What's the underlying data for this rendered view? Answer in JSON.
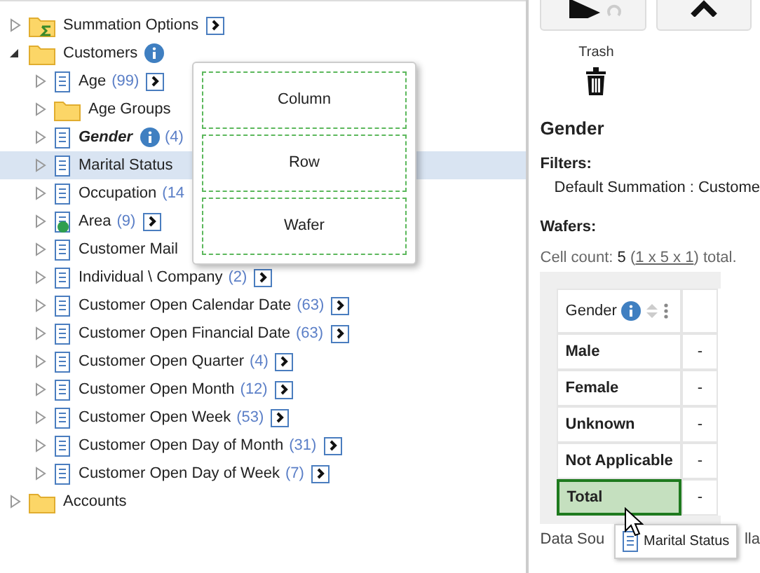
{
  "tree": [
    {
      "label": "Summation Options",
      "kind": "sum-folder",
      "expanded": false,
      "has_menu": true
    },
    {
      "label": "Customers",
      "kind": "folder",
      "expanded": true,
      "has_info": true,
      "children": [
        {
          "label": "Age",
          "count": "(99)",
          "kind": "doc",
          "expanded": false,
          "has_menu": true,
          "selected": false
        },
        {
          "label": "Age Groups",
          "kind": "folder",
          "expanded": false,
          "selected": false
        },
        {
          "label": "Gender",
          "count": "(4)",
          "kind": "doc",
          "expanded": false,
          "has_info": true,
          "emphasis": true,
          "selected": false
        },
        {
          "label": "Marital Status",
          "kind": "doc",
          "expanded": false,
          "selected": true
        },
        {
          "label": "Occupation",
          "count": "(14",
          "kind": "doc",
          "expanded": false,
          "selected": false
        },
        {
          "label": "Area",
          "count": "(9)",
          "kind": "geo",
          "expanded": false,
          "has_menu": true,
          "selected": false
        },
        {
          "label": "Customer Mail",
          "kind": "doc",
          "expanded": false,
          "selected": false
        },
        {
          "label": "Individual \\ Company",
          "count": "(2)",
          "kind": "doc",
          "expanded": false,
          "has_menu": true,
          "selected": false
        },
        {
          "label": "Customer Open Calendar Date",
          "count": "(63)",
          "kind": "doc",
          "expanded": false,
          "has_menu": true,
          "selected": false
        },
        {
          "label": "Customer Open Financial Date",
          "count": "(63)",
          "kind": "doc",
          "expanded": false,
          "has_menu": true,
          "selected": false
        },
        {
          "label": "Customer Open Quarter",
          "count": "(4)",
          "kind": "doc",
          "expanded": false,
          "has_menu": true,
          "selected": false
        },
        {
          "label": "Customer Open Month",
          "count": "(12)",
          "kind": "doc",
          "expanded": false,
          "has_menu": true,
          "selected": false
        },
        {
          "label": "Customer Open Week",
          "count": "(53)",
          "kind": "doc",
          "expanded": false,
          "has_menu": true,
          "selected": false
        },
        {
          "label": "Customer Open Day of Month",
          "count": "(31)",
          "kind": "doc",
          "expanded": false,
          "has_menu": true,
          "selected": false
        },
        {
          "label": "Customer Open Day of Week",
          "count": "(7)",
          "kind": "doc",
          "expanded": false,
          "has_menu": true,
          "selected": false
        }
      ]
    },
    {
      "label": "Accounts",
      "kind": "folder",
      "expanded": false
    }
  ],
  "drop_menu": [
    "Column",
    "Row",
    "Wafer"
  ],
  "trash_label": "Trash",
  "heading": "Gender",
  "filters_label": "Filters:",
  "filter_text": "Default Summation : Custome",
  "wafers_label": "Wafers:",
  "cell_count": {
    "prefix": "Cell count: ",
    "value": "5",
    "open": " (",
    "link": "1 x 5 x 1",
    "suffix": ") total."
  },
  "table": {
    "column": "Gender",
    "rows": [
      {
        "label": "Male",
        "value": "-",
        "selected": false
      },
      {
        "label": "Female",
        "value": "-",
        "selected": false
      },
      {
        "label": "Unknown",
        "value": "-",
        "selected": false
      },
      {
        "label": "Not Applicable",
        "value": "-",
        "selected": false
      },
      {
        "label": "Total",
        "value": "-",
        "selected": true
      }
    ]
  },
  "footer": {
    "left": "Data Sou",
    "right": "lla"
  },
  "drag_label": "Marital Status"
}
